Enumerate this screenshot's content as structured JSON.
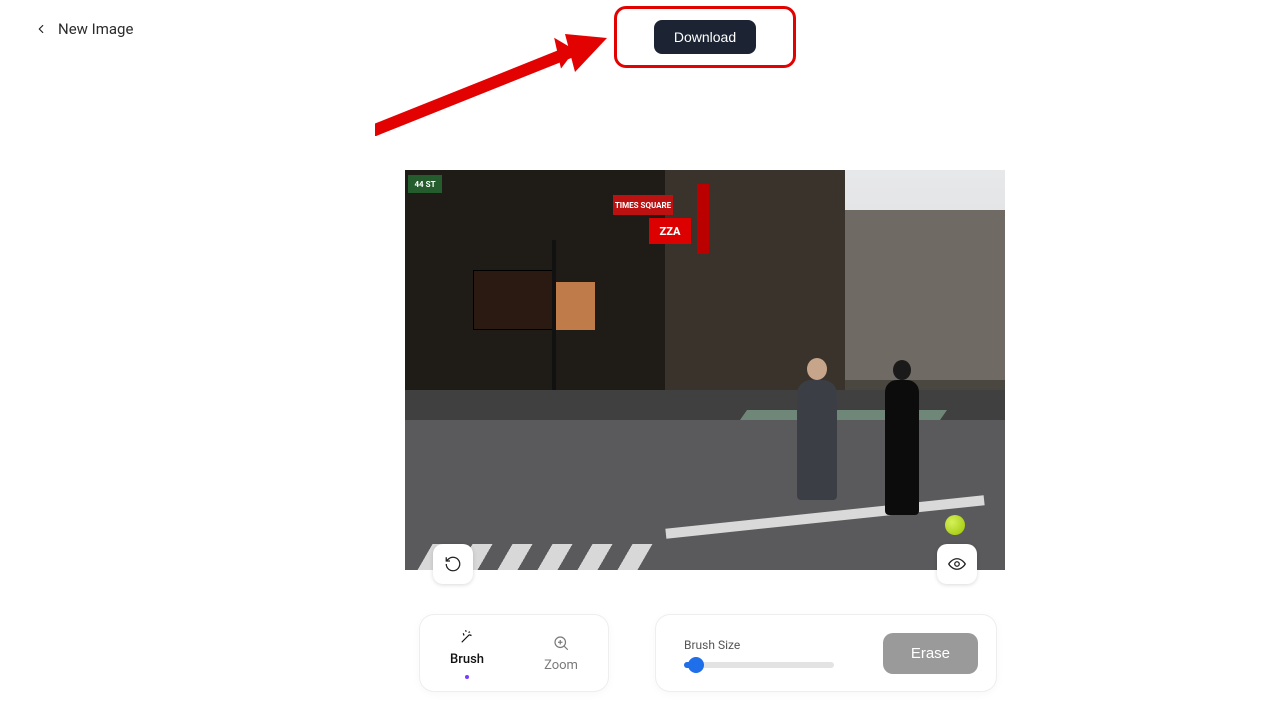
{
  "header": {
    "back_label": "New Image",
    "download_label": "Download"
  },
  "canvas": {
    "street_sign": "44 ST",
    "sign_times_square": "TIMES SQUARE",
    "sign_pizza": "ZZA"
  },
  "toolbar": {
    "brush_label": "Brush",
    "zoom_label": "Zoom"
  },
  "brush_panel": {
    "size_label": "Brush Size",
    "erase_label": "Erase"
  },
  "annotation": {
    "highlight_color": "#e30202"
  }
}
